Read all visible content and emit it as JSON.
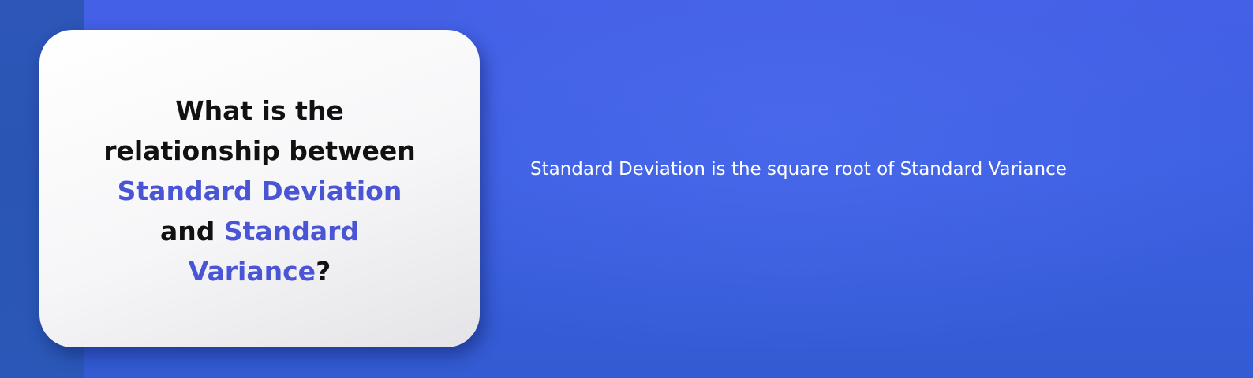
{
  "card": {
    "line1": "What is the",
    "line2": "relationship between",
    "line3_highlight": "Standard Deviation",
    "line4_prefix": "and ",
    "line4_highlight": "Standard",
    "line5_highlight": "Variance",
    "line5_suffix": "?"
  },
  "answer": {
    "text": "Standard Deviation is the square root of Standard Variance"
  },
  "colors": {
    "background": "#3a5fe0",
    "highlight": "#4a55d6",
    "card": "#ffffff",
    "answer_text": "#ffffff"
  }
}
